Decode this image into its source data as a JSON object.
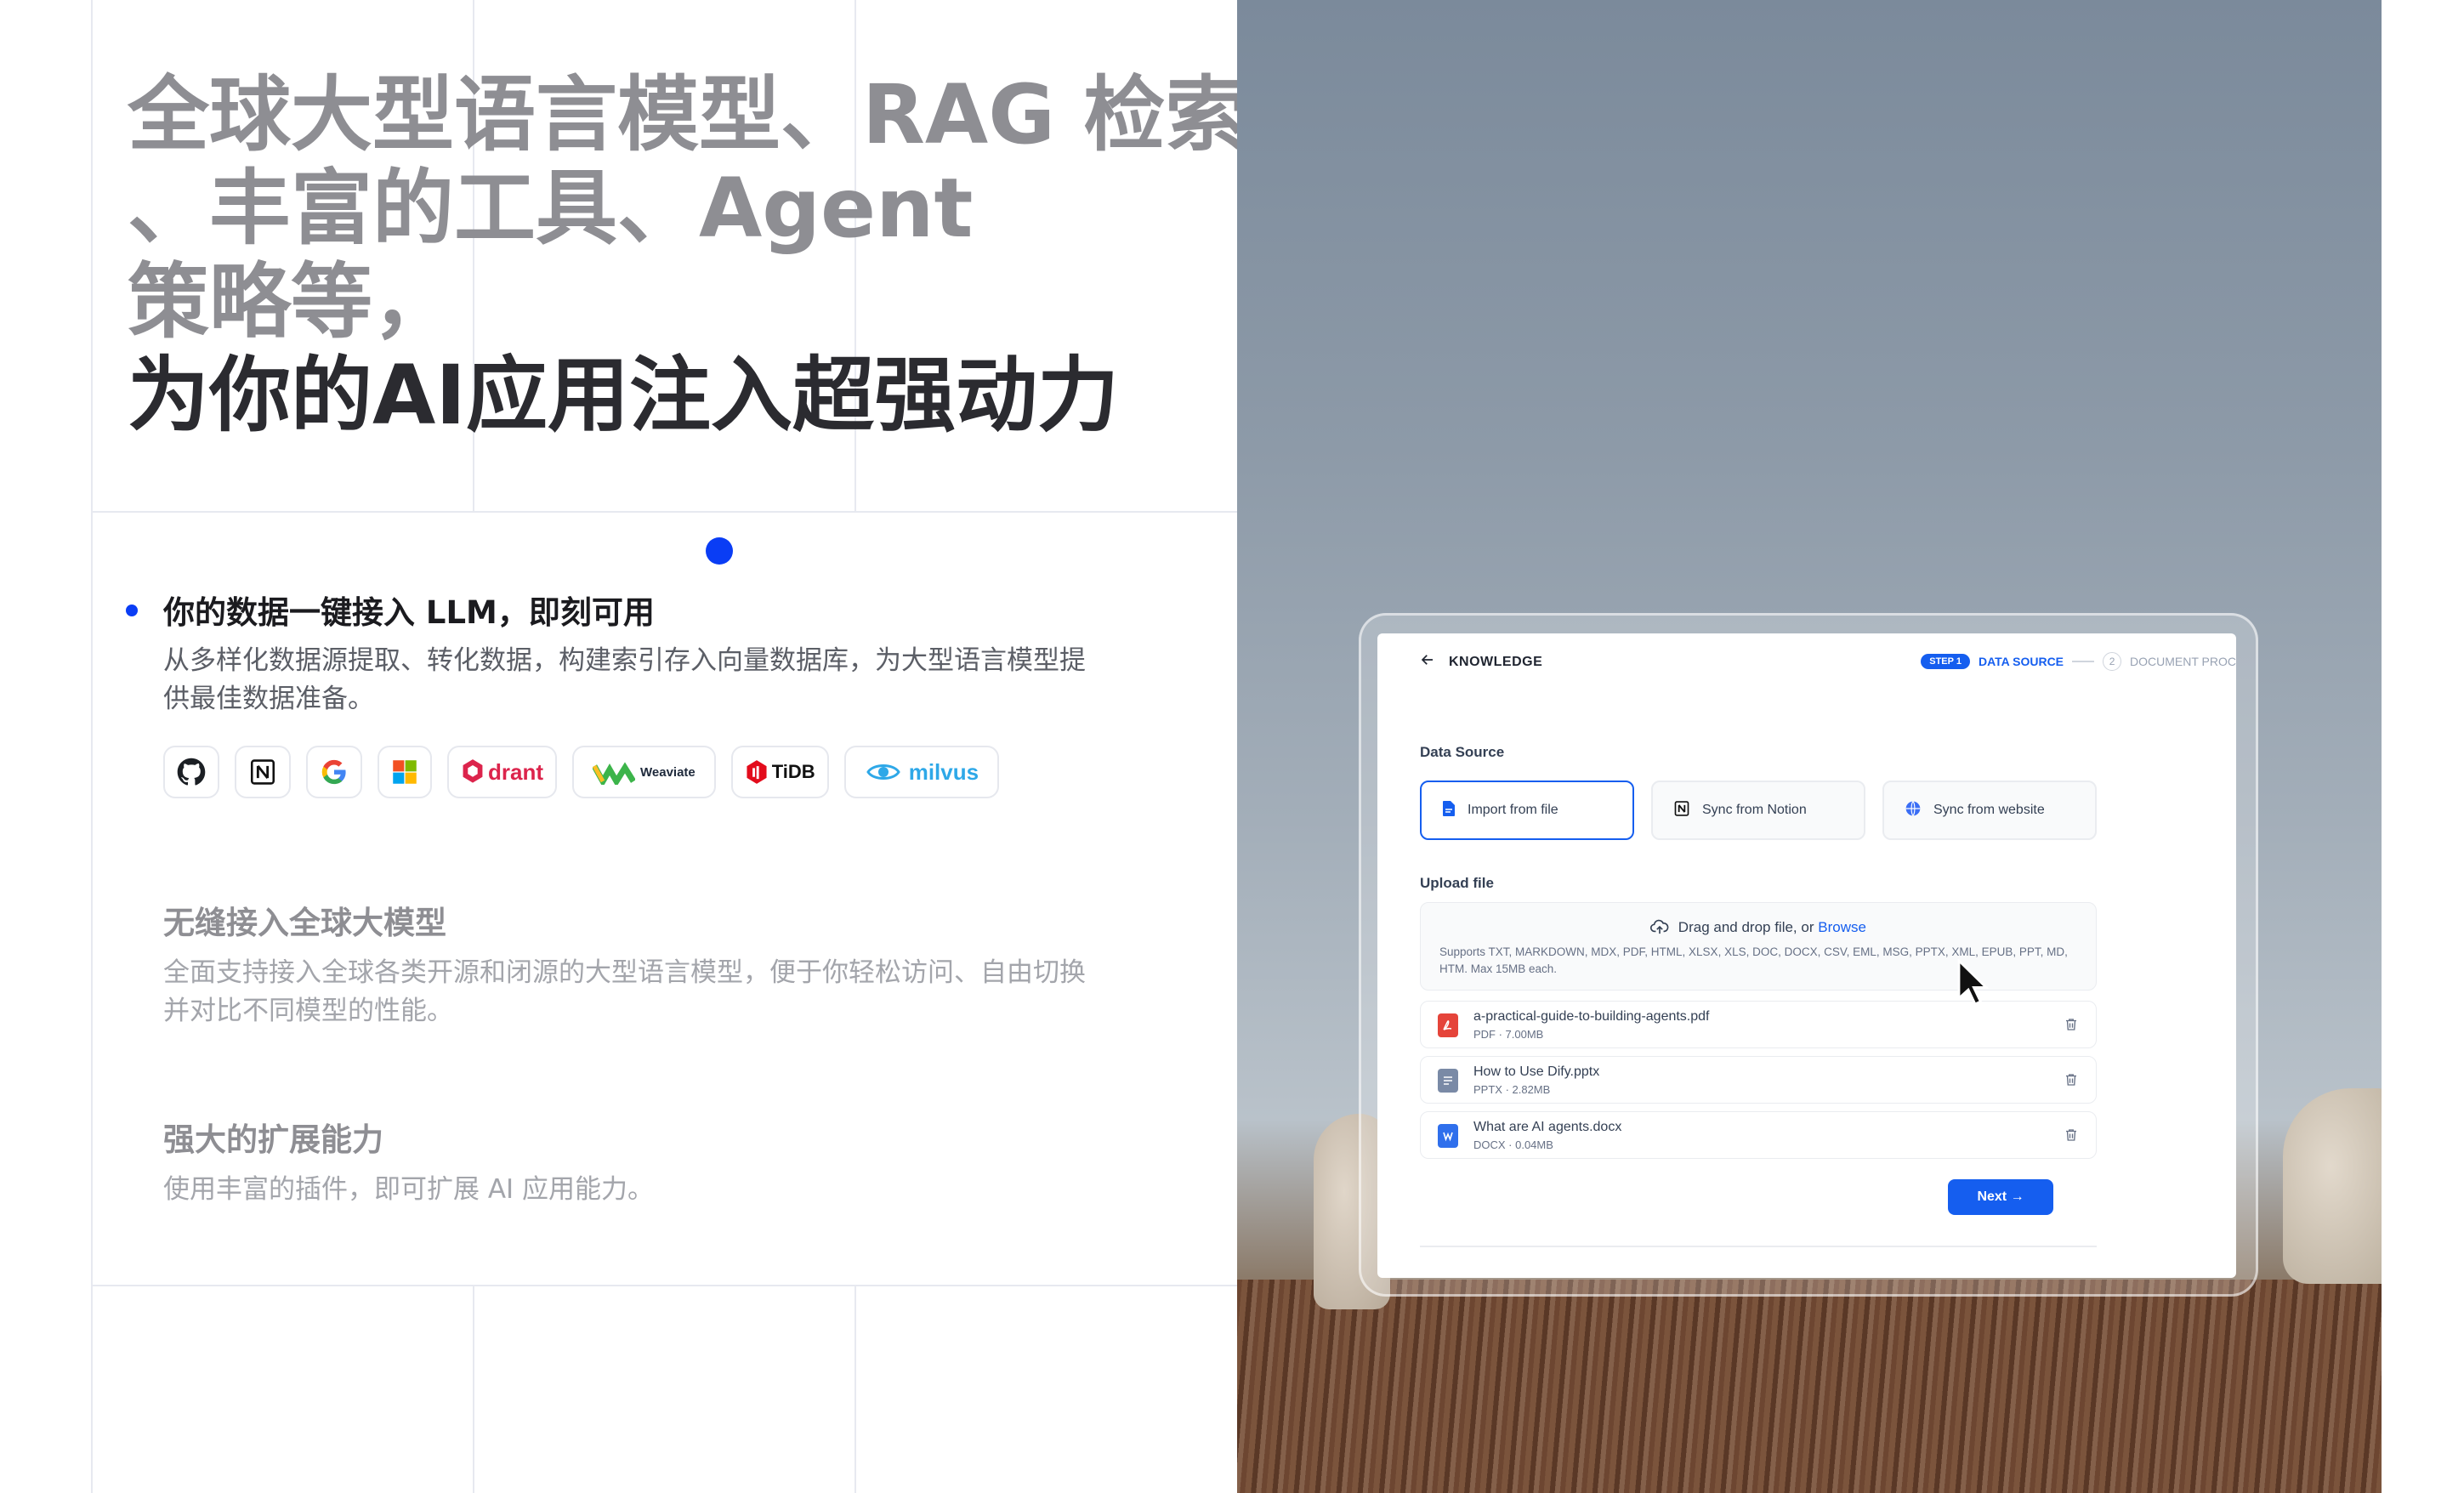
{
  "headline": {
    "line1": "全球大型语言模型、RAG 检索",
    "line2": "、丰富的工具、Agent",
    "line3": "策略等，",
    "line4": "为你的AI应用注入超强动力"
  },
  "features": [
    {
      "title": "你的数据一键接入 LLM，即刻可用",
      "desc": "从多样化数据源提取、转化数据，构建索引存入向量数据库，为大型语言模型提供最佳数据准备。"
    },
    {
      "title": "无缝接入全球大模型",
      "desc": "全面支持接入全球各类开源和闭源的大型语言模型，便于你轻松访问、自由切换并对比不同模型的性能。"
    },
    {
      "title": "强大的扩展能力",
      "desc": "使用丰富的插件，即可扩展 AI 应用能力。"
    }
  ],
  "logos": [
    {
      "icon": "github-icon"
    },
    {
      "icon": "notion-icon"
    },
    {
      "icon": "google-icon"
    },
    {
      "icon": "microsoft-icon"
    },
    {
      "icon": "qdrant-logo",
      "text": "drant"
    },
    {
      "icon": "weaviate-logo",
      "text": "Weaviate"
    },
    {
      "icon": "tidb-logo",
      "text": "TiDB"
    },
    {
      "icon": "milvus-logo",
      "text": "milvus"
    }
  ],
  "app": {
    "back_label": "KNOWLEDGE",
    "steps": {
      "step1_badge": "STEP 1",
      "step1_label": "DATA SOURCE",
      "step2_num": "2",
      "step2_label": "DOCUMENT PROC"
    },
    "data_source_label": "Data Source",
    "sources": [
      {
        "label": "Import from file",
        "icon": "file-icon",
        "active": true
      },
      {
        "label": "Sync from Notion",
        "icon": "notion-icon",
        "active": false
      },
      {
        "label": "Sync from website",
        "icon": "globe-icon",
        "active": false
      }
    ],
    "upload_label": "Upload file",
    "drop_text": "Drag and drop file, or",
    "browse_text": "Browse",
    "supports": "Supports TXT, MARKDOWN, MDX, PDF, HTML, XLSX, XLS, DOC, DOCX, CSV, EML, MSG, PPTX, XML, EPUB, PPT, MD, HTM. Max 15MB each.",
    "files": [
      {
        "name": "a-practical-guide-to-building-agents.pdf",
        "meta": "PDF · 7.00MB",
        "icon": "pdf-icon",
        "color": "#e5443a"
      },
      {
        "name": "How to Use Dify.pptx",
        "meta": "PPTX · 2.82MB",
        "icon": "pptx-icon",
        "color": "#7a8aa6"
      },
      {
        "name": "What are AI agents.docx",
        "meta": "DOCX · 0.04MB",
        "icon": "docx-icon",
        "color": "#2f6fec"
      }
    ],
    "next_label": "Next →"
  },
  "colors": {
    "accent": "#155eef",
    "bullet": "#0a3df5"
  }
}
